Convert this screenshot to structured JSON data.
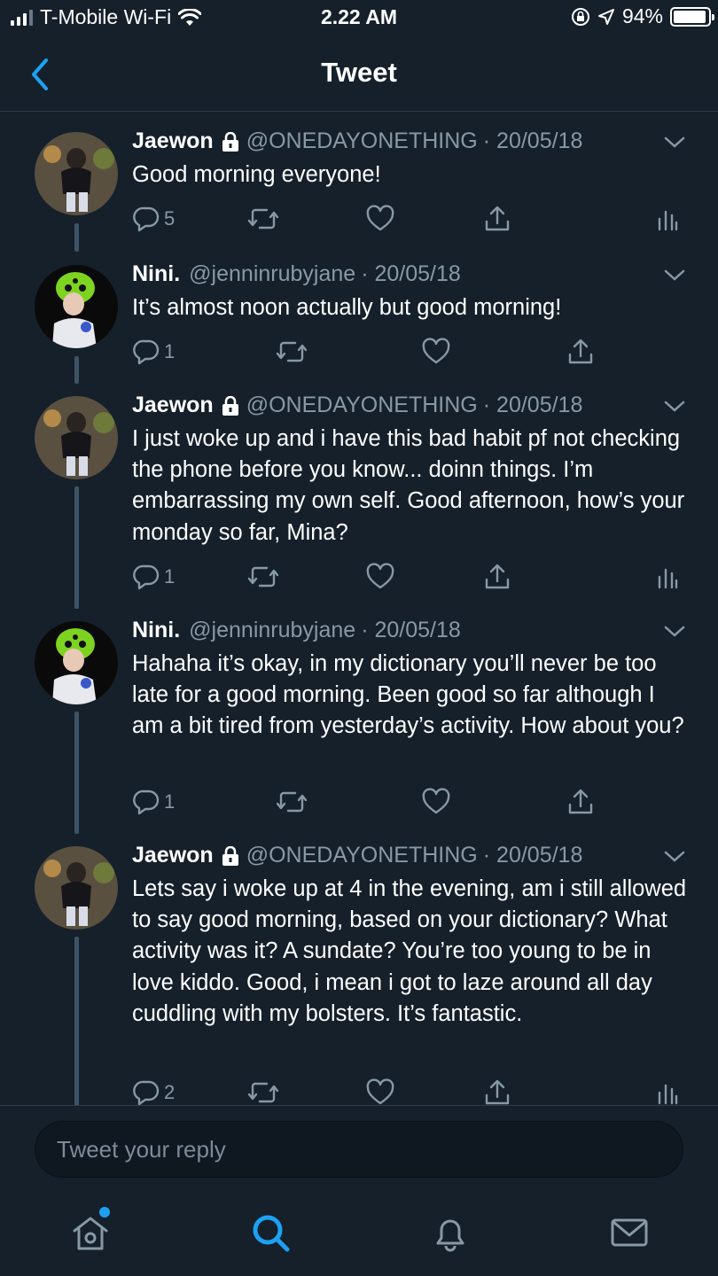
{
  "status_bar": {
    "carrier": "T-Mobile Wi-Fi",
    "time": "2.22 AM",
    "battery": "94%"
  },
  "nav": {
    "title": "Tweet"
  },
  "tweets": [
    {
      "name": "Jaewon",
      "protected": true,
      "handle": "@ONEDAYONETHING",
      "date": "· 20/05/18",
      "text": "Good morning everyone!",
      "reply_count": "5",
      "show_analytics": true
    },
    {
      "name": "Nini.",
      "protected": false,
      "handle": "@jenninrubyjane",
      "date": "· 20/05/18",
      "text": "It’s almost noon actually but good morning!",
      "reply_count": "1",
      "show_analytics": false
    },
    {
      "name": "Jaewon",
      "protected": true,
      "handle": "@ONEDAYONETHING",
      "date": "· 20/05/18",
      "text": "I just woke up and i have this bad habit pf not checking the phone before you know... doinn things. I’m embarrassing my own self. Good afternoon, how’s your monday so far, Mina?",
      "reply_count": "1",
      "show_analytics": true
    },
    {
      "name": "Nini.",
      "protected": false,
      "handle": "@jenninrubyjane",
      "date": "· 20/05/18",
      "text": "Hahaha it’s okay, in my dictionary you’ll never be too late for a good morning. Been good so far although I am a bit tired from yesterday’s activity. How about you?",
      "reply_count": "1",
      "show_analytics": false
    },
    {
      "name": "Jaewon",
      "protected": true,
      "handle": "@ONEDAYONETHING",
      "date": "· 20/05/18",
      "text": "Lets say i woke up at 4 in the evening, am i still allowed to say good morning, based on your dictionary? What activity was it? A sundate? You’re too young to be in love kiddo. Good, i mean i got to laze around all day cuddling with my bolsters. It’s fantastic.",
      "reply_count": "2",
      "show_analytics": true
    }
  ],
  "reply": {
    "placeholder": "Tweet your reply"
  },
  "tabs": [
    {
      "icon": "home-icon",
      "active": false
    },
    {
      "icon": "search-icon",
      "active": true
    },
    {
      "icon": "bell-icon",
      "active": false
    },
    {
      "icon": "mail-icon",
      "active": false
    }
  ],
  "colors": {
    "background": "#15202b",
    "accent": "#1da1f2",
    "secondary_text": "#8899a6",
    "thread_line": "#3d5466"
  }
}
